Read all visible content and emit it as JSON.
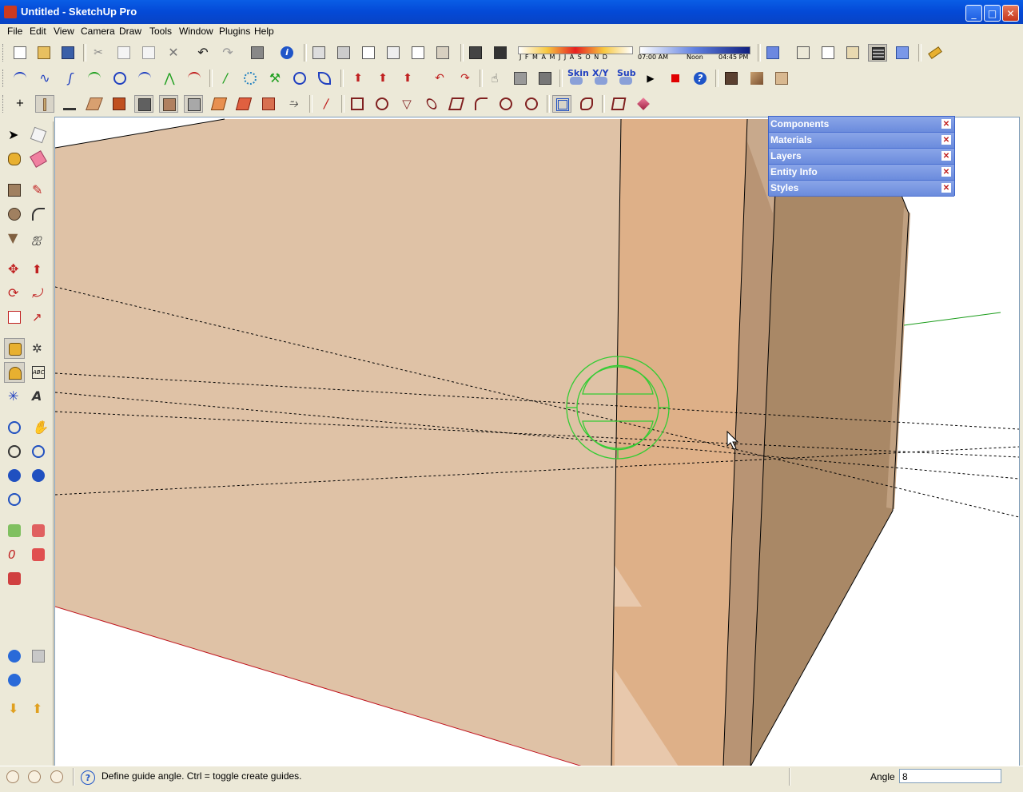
{
  "window": {
    "title": "Untitled - SketchUp Pro",
    "minimize": "_",
    "maximize": "□",
    "close": "✕"
  },
  "menu": [
    "File",
    "Edit",
    "View",
    "Camera",
    "Draw",
    "Tools",
    "Window",
    "Plugins",
    "Help"
  ],
  "shadow_bar": {
    "months": "J F M A M J J A S O N D",
    "time_start": "07:00 AM",
    "time_mid": "Noon",
    "time_end": "04:45 PM"
  },
  "plugins_bar": {
    "skin": "Skin",
    "xy": "X/Y",
    "sub": "Sub"
  },
  "trays": [
    "Components",
    "Materials",
    "Layers",
    "Entity Info",
    "Styles"
  ],
  "tray_close": "✕",
  "status": {
    "help_icon": "?",
    "text": "Define guide angle.  Ctrl = toggle create guides.",
    "vcb_label": "Angle",
    "vcb_value": "8"
  },
  "colors": {
    "axis_red": "#c0161f",
    "axis_green": "#1a9c1a",
    "face_light": "#dfc2a6",
    "face_mid": "#deb088",
    "face_dark": "#a98866",
    "protractor": "#33cc33"
  }
}
